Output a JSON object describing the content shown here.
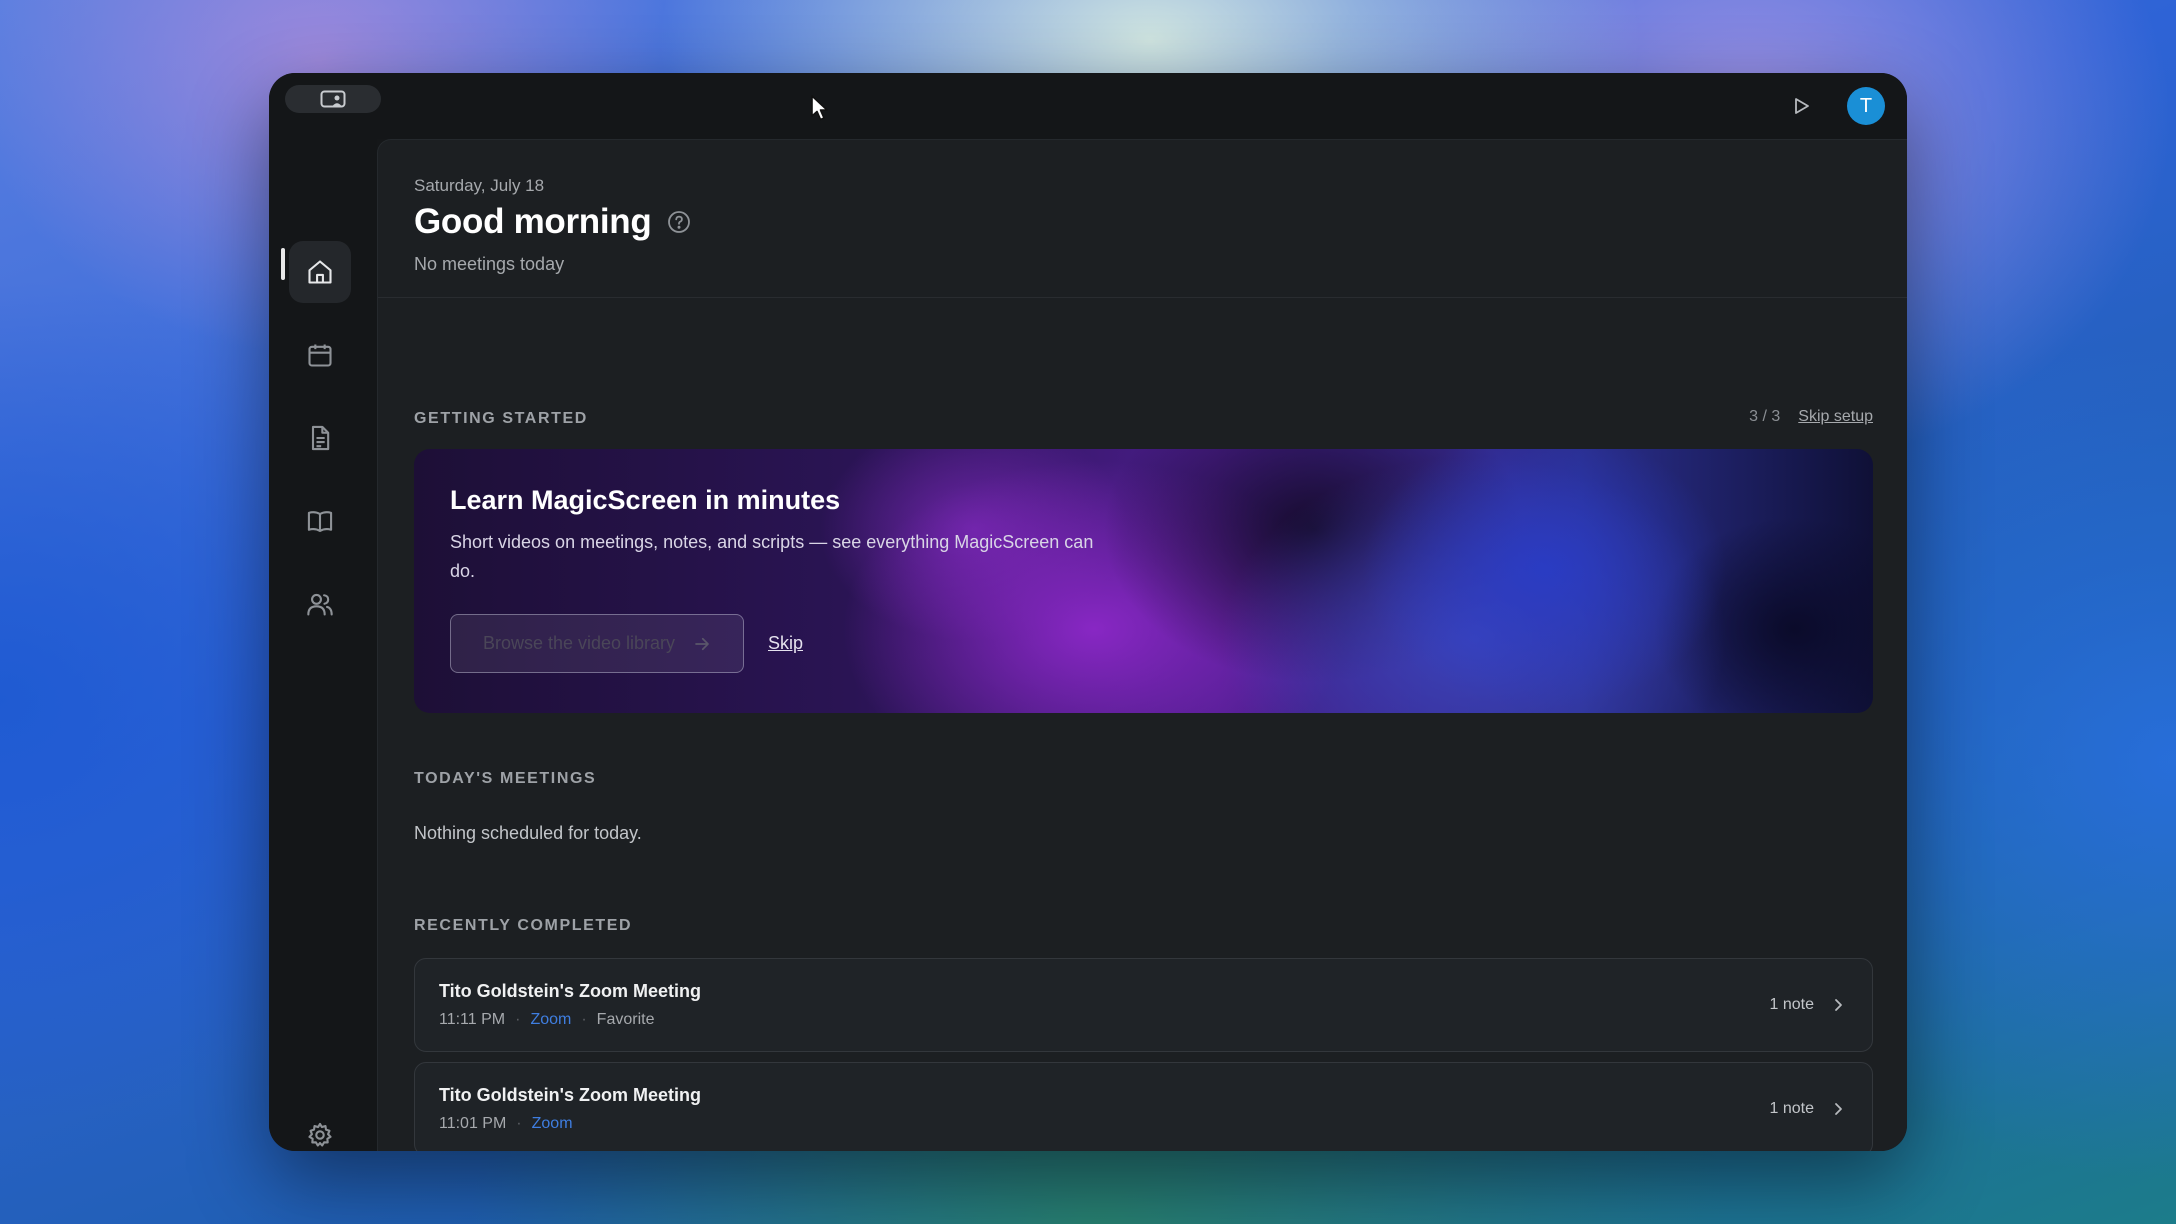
{
  "header": {
    "date": "Saturday, July 18",
    "greeting": "Good morning",
    "subtitle": "No meetings today"
  },
  "getting_started": {
    "label": "GETTING STARTED",
    "progress": "3 / 3",
    "skip_setup": "Skip setup",
    "banner": {
      "title": "Learn MagicScreen in minutes",
      "description": "Short videos on meetings, notes, and scripts — see everything MagicScreen can do.",
      "primary_button": "Browse the video library",
      "skip": "Skip"
    }
  },
  "todays_meetings": {
    "label": "TODAY'S MEETINGS",
    "empty": "Nothing scheduled for today."
  },
  "recently_completed": {
    "label": "RECENTLY COMPLETED",
    "items": [
      {
        "title": "Tito Goldstein's Zoom Meeting",
        "time": "11:11 PM",
        "platform": "Zoom",
        "tag": "Favorite",
        "notes": "1 note"
      },
      {
        "title": "Tito Goldstein's Zoom Meeting",
        "time": "11:01 PM",
        "platform": "Zoom",
        "tag": "",
        "notes": "1 note"
      }
    ]
  },
  "user": {
    "avatar_initial": "T",
    "avatar_color": "#1a8fd6"
  },
  "nav": {
    "items": [
      "home-icon",
      "calendar-icon",
      "document-icon",
      "book-icon",
      "users-icon"
    ],
    "footer": "gear-icon",
    "active": "home-icon"
  }
}
